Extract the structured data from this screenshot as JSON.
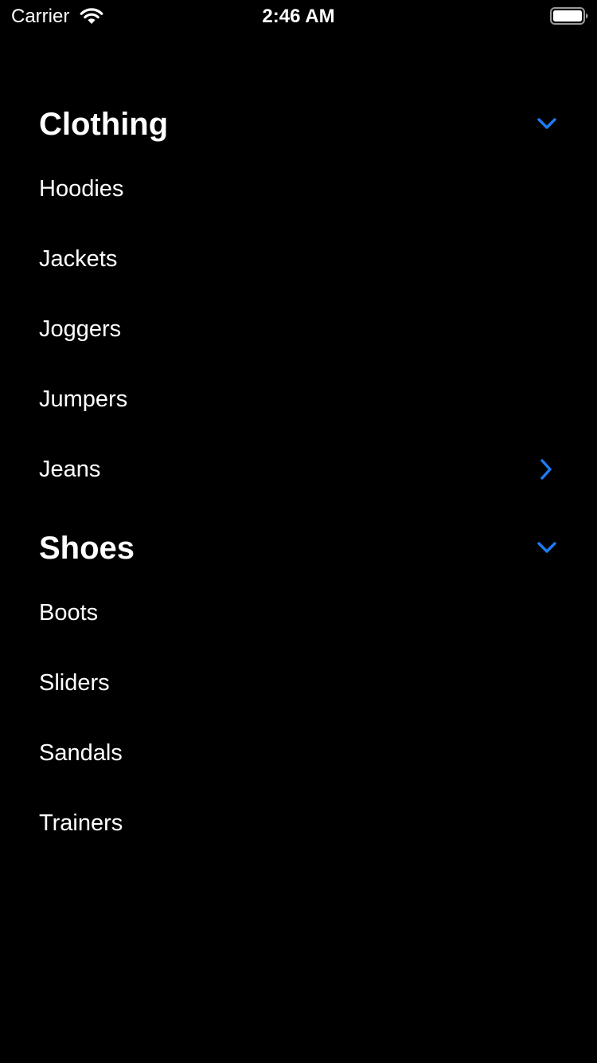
{
  "status_bar": {
    "carrier": "Carrier",
    "time": "2:46 AM",
    "wifi_icon": "wifi-icon",
    "battery_icon": "battery-icon"
  },
  "accent_color": "#1C7CF4",
  "sections": [
    {
      "title": "Clothing",
      "expanded": true,
      "toggle_icon": "chevron-down-icon",
      "items": [
        {
          "label": "Hoodies"
        },
        {
          "label": "Jackets"
        },
        {
          "label": "Joggers"
        },
        {
          "label": "Jumpers"
        },
        {
          "label": "Jeans",
          "disclosure_icon": "chevron-right-icon"
        }
      ]
    },
    {
      "title": "Shoes",
      "expanded": true,
      "toggle_icon": "chevron-down-icon",
      "items": [
        {
          "label": "Boots"
        },
        {
          "label": "Sliders"
        },
        {
          "label": "Sandals"
        },
        {
          "label": "Trainers"
        }
      ]
    }
  ]
}
